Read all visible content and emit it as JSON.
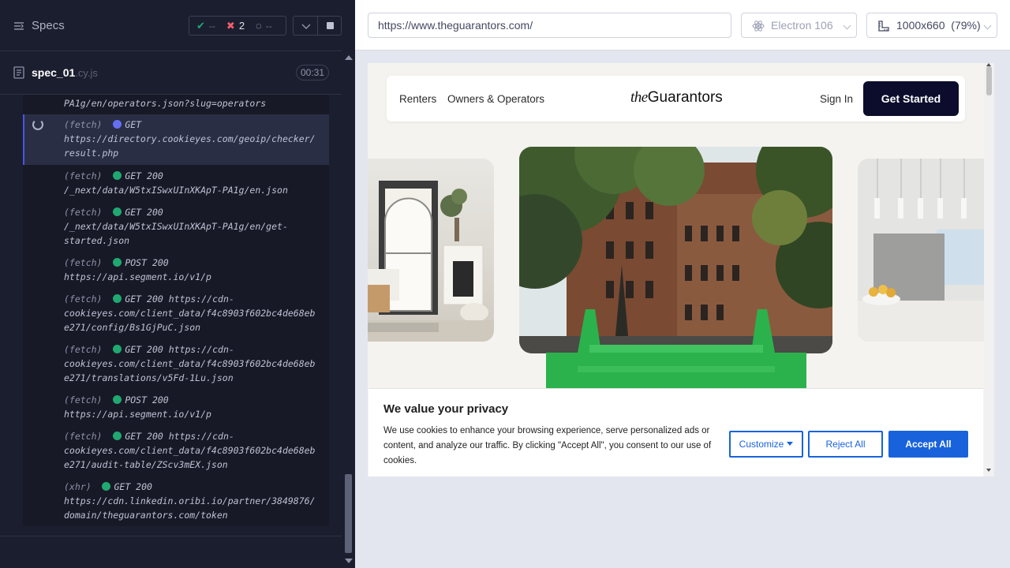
{
  "runner": {
    "specs_label": "Specs",
    "stats": {
      "passed": "--",
      "failed": "2",
      "pending": "--"
    },
    "spec": {
      "name": "spec_01",
      "ext": ".cy.js",
      "duration": "00:31"
    },
    "log_top_fragment": "PA1g/en/operators.json?slug=operators",
    "active_entry": {
      "type": "(fetch)",
      "method": "GET",
      "url_lines": [
        "https://directory.cookieyes.com/geoip/checker/",
        "result.php"
      ]
    },
    "entries": [
      {
        "type": "(fetch)",
        "method": "GET 200",
        "url_lines": [
          "/_next/data/W5txISwxUInXKApT-PA1g/en.json"
        ]
      },
      {
        "type": "(fetch)",
        "method": "GET 200",
        "url_lines": [
          "/_next/data/W5txISwxUInXKApT-PA1g/en/get-",
          "started.json"
        ]
      },
      {
        "type": "(fetch)",
        "method": "POST 200",
        "url_lines": [
          "https://api.segment.io/v1/p"
        ]
      },
      {
        "type": "(fetch)",
        "method": "GET 200 https://cdn-",
        "url_lines": [
          "cookieyes.com/client_data/f4c8903f602bc4de68eb",
          "e271/config/Bs1GjPuC.json"
        ]
      },
      {
        "type": "(fetch)",
        "method": "GET 200 https://cdn-",
        "url_lines": [
          "cookieyes.com/client_data/f4c8903f602bc4de68eb",
          "e271/translations/v5Fd-1Lu.json"
        ]
      },
      {
        "type": "(fetch)",
        "method": "POST 200",
        "url_lines": [
          "https://api.segment.io/v1/p"
        ]
      },
      {
        "type": "(fetch)",
        "method": "GET 200 https://cdn-",
        "url_lines": [
          "cookieyes.com/client_data/f4c8903f602bc4de68eb",
          "e271/audit-table/ZScv3mEX.json"
        ]
      },
      {
        "type": "(xhr)",
        "method": "GET 200",
        "url_lines": [
          "https://cdn.linkedin.oribi.io/partner/3849876/",
          "domain/theguarantors.com/token"
        ]
      }
    ],
    "colors": {
      "success": "#1fa971",
      "pending": "#6470f3",
      "failed": "#f15d6b"
    }
  },
  "browser_bar": {
    "url": "https://www.theguarantors.com/",
    "browser": "Electron 106",
    "viewport": "1000x660",
    "zoom": "(79%)"
  },
  "site": {
    "nav": {
      "renters": "Renters",
      "owners": "Owners & Operators",
      "logo_italic": "the",
      "logo_rest": "Guarantors",
      "sign_in": "Sign In",
      "cta": "Get Started"
    },
    "cookie": {
      "title": "We value your privacy",
      "text": "We use cookies to enhance your browsing experience, serve personalized ads or content, and analyze our traffic. By clicking \"Accept All\", you consent to our use of cookies.",
      "customize": "Customize",
      "reject": "Reject All",
      "accept": "Accept All"
    }
  }
}
